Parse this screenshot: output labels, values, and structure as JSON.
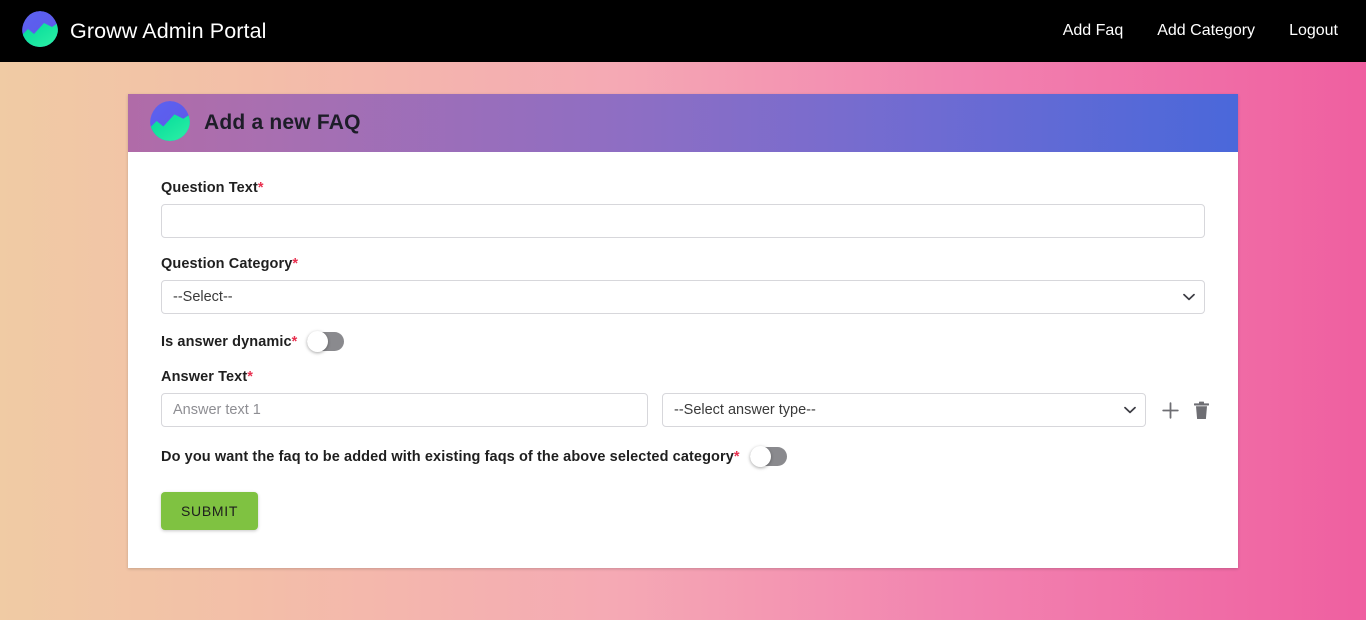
{
  "navbar": {
    "brand_label": "Groww Admin Portal",
    "logo_icon": "groww-logo-icon",
    "links": [
      {
        "label": "Add Faq",
        "name": "nav-link-add-faq"
      },
      {
        "label": "Add Category",
        "name": "nav-link-add-category"
      },
      {
        "label": "Logout",
        "name": "nav-link-logout"
      }
    ]
  },
  "card": {
    "header": {
      "title": "Add a new FAQ",
      "logo_icon": "groww-logo-icon"
    },
    "form": {
      "question_text": {
        "label": "Question Text",
        "required_marker": "*",
        "value": "",
        "placeholder": ""
      },
      "question_category": {
        "label": "Question Category",
        "required_marker": "*",
        "selected": "--Select--",
        "options": [
          "--Select--"
        ]
      },
      "is_answer_dynamic": {
        "label": "Is answer dynamic",
        "required_marker": "*",
        "state": "off"
      },
      "answer_text": {
        "label": "Answer Text",
        "required_marker": "*",
        "value": "",
        "placeholder": "Answer text 1",
        "answer_type": {
          "selected": "--Select answer type--",
          "options": [
            "--Select answer type--"
          ]
        },
        "add_icon": "plus-icon",
        "delete_icon": "trash-icon"
      },
      "add_with_existing": {
        "label": "Do you want the faq to be added with existing faqs of the above selected category",
        "required_marker": "*",
        "state": "off"
      },
      "submit_label": "SUBMIT"
    }
  },
  "colors": {
    "navbar_bg": "#000000",
    "page_gradient_start": "#f0cba4",
    "page_gradient_end": "#ef5fa0",
    "card_header_gradient_start": "#b06ba8",
    "card_header_gradient_end": "#4a68da",
    "submit_green": "#7fc241",
    "required_red": "#e8304f",
    "toggle_off_track": "#8a8a8e"
  }
}
